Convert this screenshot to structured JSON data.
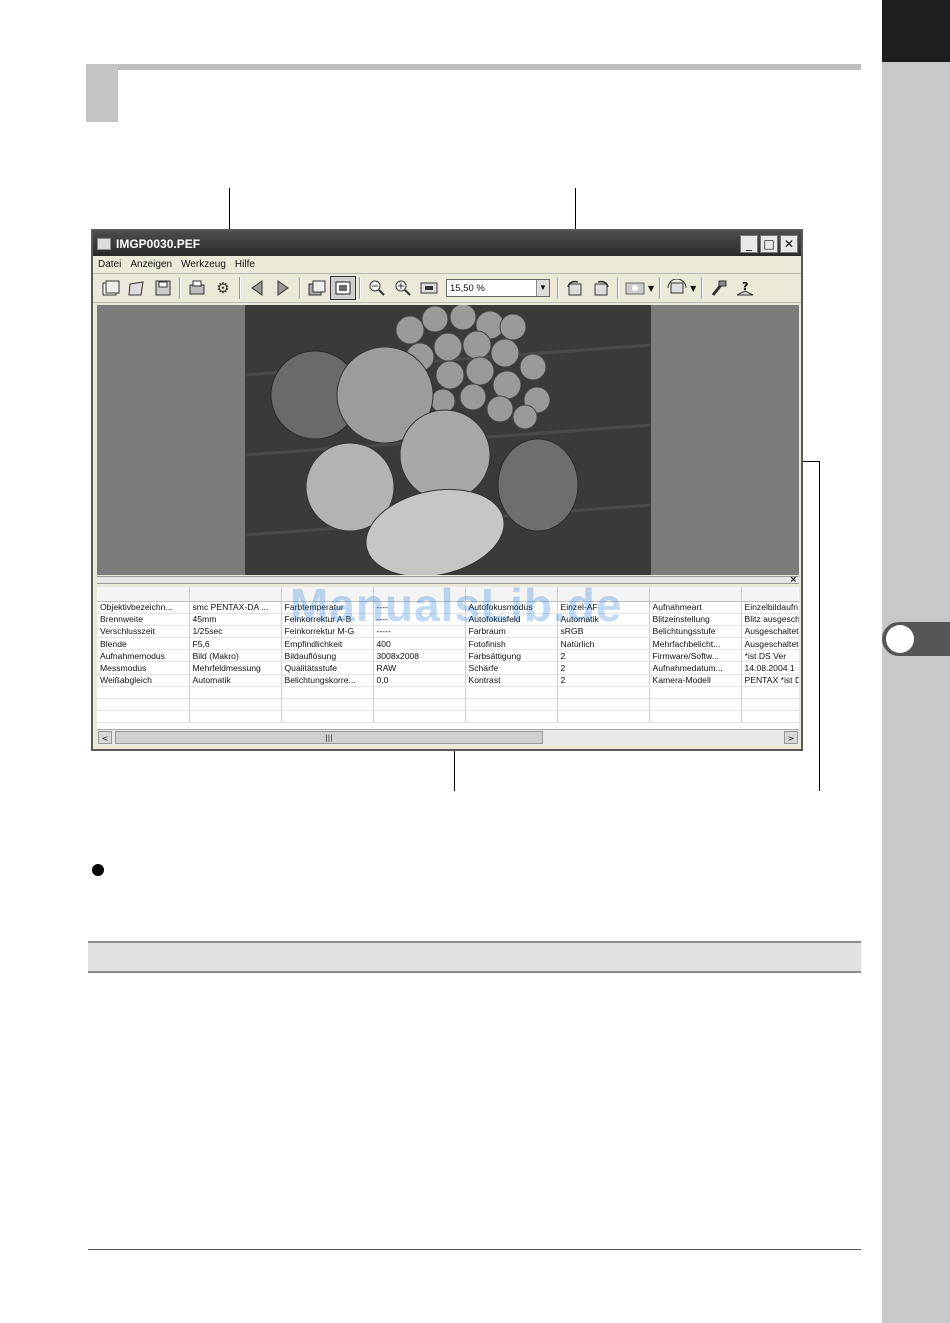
{
  "window": {
    "title": "IMGP0030.PEF",
    "buttons": {
      "minimize": "_",
      "maximize": "□",
      "close": "✕"
    }
  },
  "menu": [
    "Datei",
    "Anzeigen",
    "Werkzeug",
    "Hilfe"
  ],
  "toolbar": {
    "zoom_value": "15,50 %",
    "icons": [
      "new-window-icon",
      "open-folder-icon",
      "save-icon",
      "print-icon",
      "settings-gear-icon",
      "previous-icon",
      "next-icon",
      "fullscreen-icon",
      "fit-window-icon",
      "zoom-out-icon",
      "zoom-in-icon",
      "actual-size-icon",
      "rotate-left-icon",
      "rotate-right-icon",
      "display-mode-icon",
      "transform-icon",
      "adjust-tool-icon",
      "help-icon"
    ]
  },
  "info_table": {
    "rows": [
      [
        "Objektivbezeichn...",
        "smc PENTAX-DA ...",
        "Farbtemperatur",
        "----",
        "Autofokusmodus",
        "Einzel-AF",
        "Aufnahmeart",
        "Einzelbildaufn"
      ],
      [
        "Brennweite",
        "45mm",
        "Feinkorrektur A-B",
        "----",
        "Autofokusfeld",
        "Automatik",
        "Blitzeinstellung",
        "Blitz ausgesch"
      ],
      [
        "Verschlusszeit",
        "1/25sec",
        "Feinkorrektur M-G",
        "-----",
        "Farbraum",
        "sRGB",
        "Belichtungsstufe",
        "Ausgeschaltet"
      ],
      [
        "Blende",
        "F5,6",
        "Empfindlichkeit",
        "400",
        "Fotofinish",
        "Natürlich",
        "Mehrfachbelicht...",
        "Ausgeschaltet"
      ],
      [
        "Aufnahmemodus",
        "Bild (Makro)",
        "Bildauflösung",
        "3008x2008",
        "Farbsättigung",
        "2",
        "Firmware/Softw...",
        "*ist DS   Ver"
      ],
      [
        "Messmodus",
        "Mehrfeldmessung",
        "Qualitätsstufe",
        "RAW",
        "Schärfe",
        "2",
        "Aufnahmedatum...",
        "14.08.2004 1"
      ],
      [
        "Weißabgleich",
        "Automatik",
        "Belichtungskorre...",
        "0,0",
        "Kontrast",
        "2",
        "Kamera-Modell",
        "PENTAX *ist D"
      ]
    ]
  },
  "scrollbar": {
    "left_arrow": "<",
    "thumb_grip": "|||",
    "right_arrow": ">"
  },
  "splitter_close": "×",
  "watermark": "ManualsLib.de"
}
